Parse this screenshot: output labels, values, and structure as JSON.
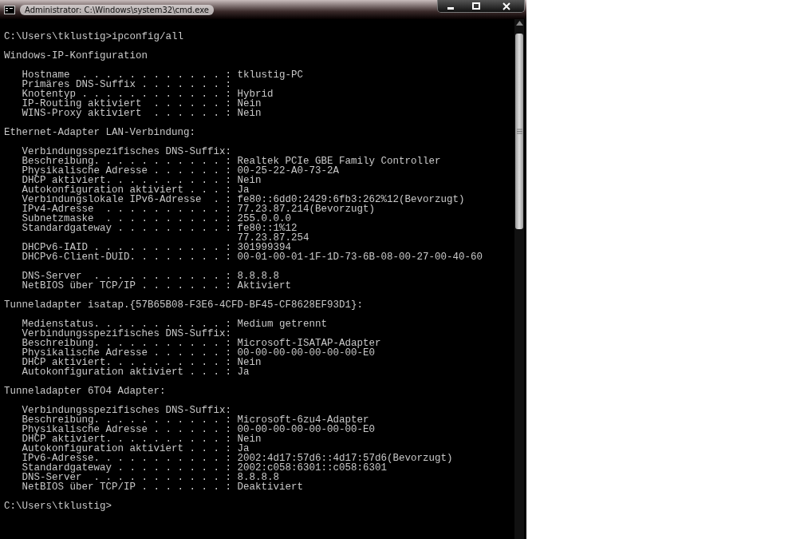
{
  "window": {
    "title": "Administrator: C:\\Windows\\system32\\cmd.exe"
  },
  "console_lines": [
    {
      "kind": "text",
      "text": "C:\\Users\\tklustig>ipconfig/all"
    },
    {
      "kind": "blank"
    },
    {
      "kind": "text",
      "text": "Windows-IP-Konfiguration"
    },
    {
      "kind": "blank"
    },
    {
      "kind": "text",
      "text": "   Hostname  . . . . . . . . . . . . : tklustig-PC"
    },
    {
      "kind": "text",
      "text": "   Primäres DNS-Suffix . . . . . . . :"
    },
    {
      "kind": "text",
      "text": "   Knotentyp . . . . . . . . . . . . : Hybrid"
    },
    {
      "kind": "text",
      "text": "   IP-Routing aktiviert  . . . . . . : Nein"
    },
    {
      "kind": "text",
      "text": "   WINS-Proxy aktiviert  . . . . . . : Nein"
    },
    {
      "kind": "blank"
    },
    {
      "kind": "text",
      "text": "Ethernet-Adapter LAN-Verbindung:"
    },
    {
      "kind": "blank"
    },
    {
      "kind": "text",
      "text": "   Verbindungsspezifisches DNS-Suffix:"
    },
    {
      "kind": "text",
      "text": "   Beschreibung. . . . . . . . . . . : Realtek PCIe GBE Family Controller"
    },
    {
      "kind": "text",
      "text": "   Physikalische Adresse . . . . . . : 00-25-22-A0-73-2A"
    },
    {
      "kind": "text",
      "text": "   DHCP aktiviert. . . . . . . . . . : Nein"
    },
    {
      "kind": "text",
      "text": "   Autokonfiguration aktiviert . . . : Ja"
    },
    {
      "kind": "text",
      "text": "   Verbindungslokale IPv6-Adresse  . : fe80::6dd0:2429:6fb3:262%12(Bevorzugt)"
    },
    {
      "kind": "text",
      "text": "   IPv4-Adresse  . . . . . . . . . . : 77.23.87.214(Bevorzugt)"
    },
    {
      "kind": "text",
      "text": "   Subnetzmaske  . . . . . . . . . . : 255.0.0.0"
    },
    {
      "kind": "text",
      "text": "   Standardgateway . . . . . . . . . : fe80::1%12"
    },
    {
      "kind": "text",
      "text": "                                       77.23.87.254"
    },
    {
      "kind": "text",
      "text": "   DHCPv6-IAID . . . . . . . . . . . : 301999394"
    },
    {
      "kind": "text",
      "text": "   DHCPv6-Client-DUID. . . . . . . . : 00-01-00-01-1F-1D-73-6B-08-00-27-00-40-60"
    },
    {
      "kind": "blank"
    },
    {
      "kind": "text",
      "text": "   DNS-Server  . . . . . . . . . . . : 8.8.8.8"
    },
    {
      "kind": "text",
      "text": "   NetBIOS über TCP/IP . . . . . . . : Aktiviert"
    },
    {
      "kind": "blank"
    },
    {
      "kind": "text",
      "text": "Tunneladapter isatap.{57B65B08-F3E6-4CFD-BF45-CF8628EF93D1}:"
    },
    {
      "kind": "blank"
    },
    {
      "kind": "text",
      "text": "   Medienstatus. . . . . . . . . . . : Medium getrennt"
    },
    {
      "kind": "text",
      "text": "   Verbindungsspezifisches DNS-Suffix:"
    },
    {
      "kind": "text",
      "text": "   Beschreibung. . . . . . . . . . . : Microsoft-ISATAP-Adapter"
    },
    {
      "kind": "text",
      "text": "   Physikalische Adresse . . . . . . : 00-00-00-00-00-00-00-E0"
    },
    {
      "kind": "text",
      "text": "   DHCP aktiviert. . . . . . . . . . : Nein"
    },
    {
      "kind": "text",
      "text": "   Autokonfiguration aktiviert . . . : Ja"
    },
    {
      "kind": "blank"
    },
    {
      "kind": "text",
      "text": "Tunneladapter 6TO4 Adapter:"
    },
    {
      "kind": "blank"
    },
    {
      "kind": "text",
      "text": "   Verbindungsspezifisches DNS-Suffix:"
    },
    {
      "kind": "text",
      "text": "   Beschreibung. . . . . . . . . . . : Microsoft-6zu4-Adapter"
    },
    {
      "kind": "text",
      "text": "   Physikalische Adresse . . . . . . : 00-00-00-00-00-00-00-E0"
    },
    {
      "kind": "text",
      "text": "   DHCP aktiviert. . . . . . . . . . : Nein"
    },
    {
      "kind": "text",
      "text": "   Autokonfiguration aktiviert . . . : Ja"
    },
    {
      "kind": "text",
      "text": "   IPv6-Adresse. . . . . . . . . . . : 2002:4d17:57d6::4d17:57d6(Bevorzugt)"
    },
    {
      "kind": "text",
      "text": "   Standardgateway . . . . . . . . . : 2002:c058:6301::c058:6301"
    },
    {
      "kind": "text",
      "text": "   DNS-Server  . . . . . . . . . . . : 8.8.8.8"
    },
    {
      "kind": "text",
      "text": "   NetBIOS über TCP/IP . . . . . . . : Deaktiviert"
    },
    {
      "kind": "blank"
    },
    {
      "kind": "text",
      "text": "C:\\Users\\tklustig>"
    }
  ]
}
